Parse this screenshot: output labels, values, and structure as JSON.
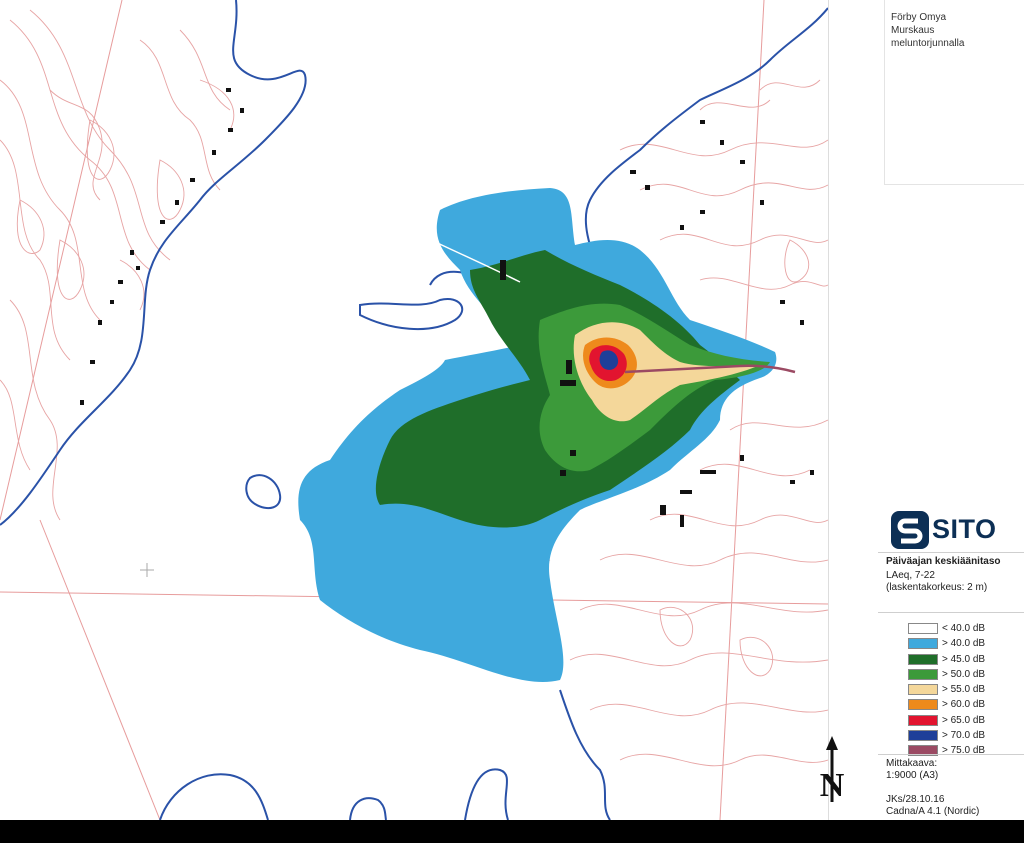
{
  "title_block": {
    "line1": "Förby Omya",
    "line2": "Murskaus",
    "line3": "meluntorjunnalla"
  },
  "logo": {
    "text": "SITO",
    "color": "#0c2f55"
  },
  "panel": {
    "heading": "Päiväajan keskiäänitaso",
    "metric": "LAeq, 7-22",
    "height_note": "(laskentakorkeus: 2 m)",
    "scale_label": "Mittakaava:",
    "scale_value": "1:9000 (A3)",
    "author_date": "JKs/28.10.16",
    "software": "Cadna/A 4.1 (Nordic)"
  },
  "legend": [
    {
      "label": "< 40.0 dB",
      "color": "#ffffff"
    },
    {
      "label": "> 40.0 dB",
      "color": "#3fa9dd"
    },
    {
      "label": "> 45.0 dB",
      "color": "#1f6e2a"
    },
    {
      "label": "> 50.0 dB",
      "color": "#3c9a3a"
    },
    {
      "label": "> 55.0 dB",
      "color": "#f4d79a"
    },
    {
      "label": "> 60.0 dB",
      "color": "#ee8a1c"
    },
    {
      "label": "> 65.0 dB",
      "color": "#e2142f"
    },
    {
      "label": "> 70.0 dB",
      "color": "#1f3f99"
    },
    {
      "label": "> 75.0 dB",
      "color": "#9b4a63"
    }
  ],
  "north_arrow": {
    "letter": "N"
  },
  "map_colors": {
    "contour": "#e7a4a4",
    "shoreline": "#2a52a8",
    "building": "#111111"
  }
}
